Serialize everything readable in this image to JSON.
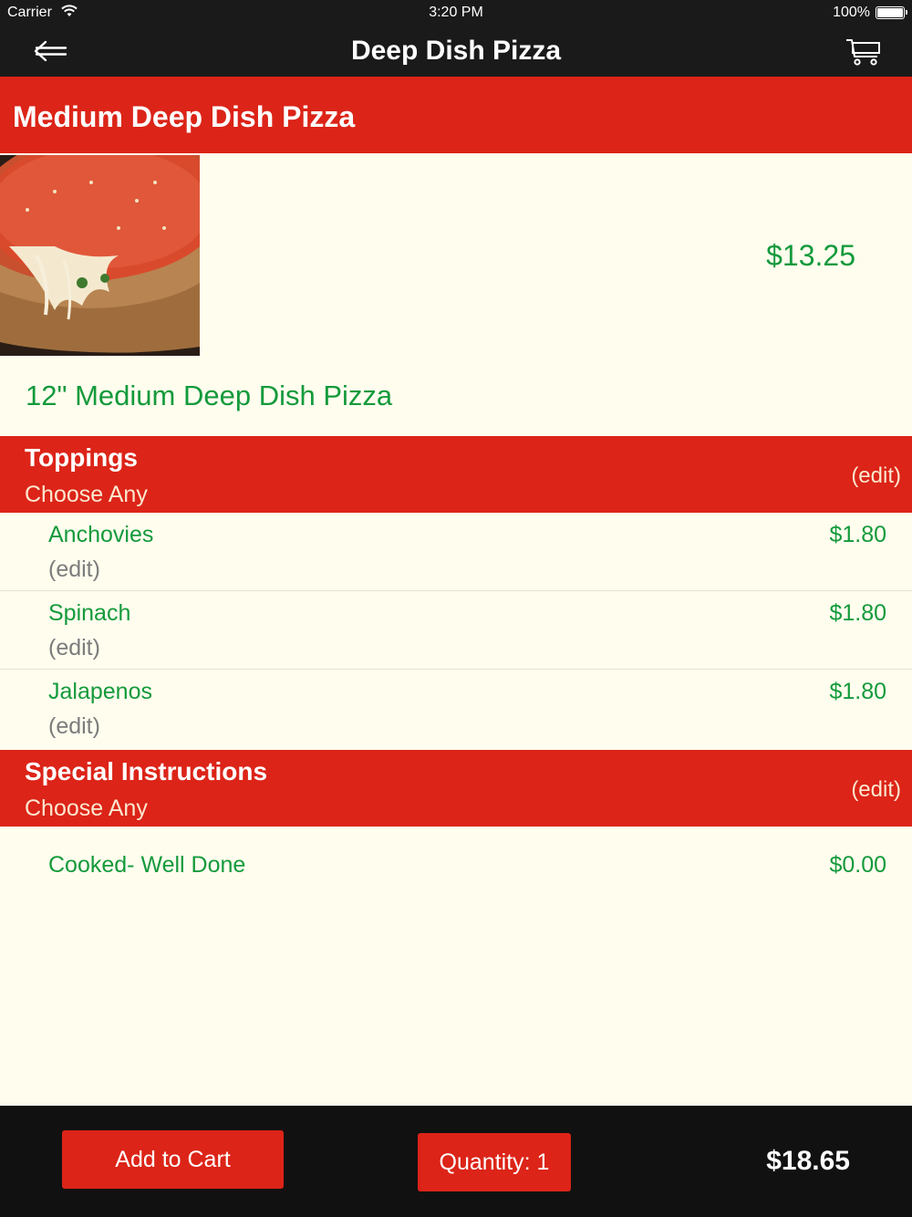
{
  "status_bar": {
    "carrier": "Carrier",
    "time": "3:20 PM",
    "battery": "100%"
  },
  "nav": {
    "title": "Deep Dish Pizza",
    "back_icon": "back-arrow-icon",
    "cart_icon": "cart-icon"
  },
  "item": {
    "name": "Medium Deep Dish Pizza",
    "price": "$13.25",
    "description": "12\" Medium Deep Dish Pizza"
  },
  "toppings": {
    "title": "Toppings",
    "subtitle": "Choose Any",
    "edit_label": "(edit)",
    "options": [
      {
        "name": "Anchovies",
        "edit": "(edit)",
        "price": "$1.80"
      },
      {
        "name": "Spinach",
        "edit": "(edit)",
        "price": "$1.80"
      },
      {
        "name": "Jalapenos",
        "edit": "(edit)",
        "price": "$1.80"
      }
    ]
  },
  "special_instructions": {
    "title": "Special Instructions",
    "subtitle": "Choose Any",
    "edit_label": "(edit)",
    "options": [
      {
        "name": "Cooked- Well Done",
        "price": "$0.00"
      }
    ]
  },
  "footer": {
    "add_to_cart": "Add to Cart",
    "quantity": "Quantity: 1",
    "total": "$18.65"
  },
  "colors": {
    "accent_red": "#dc2418",
    "price_green": "#149a3c",
    "background": "#fffdee",
    "bar_black": "#1a1a1a"
  }
}
